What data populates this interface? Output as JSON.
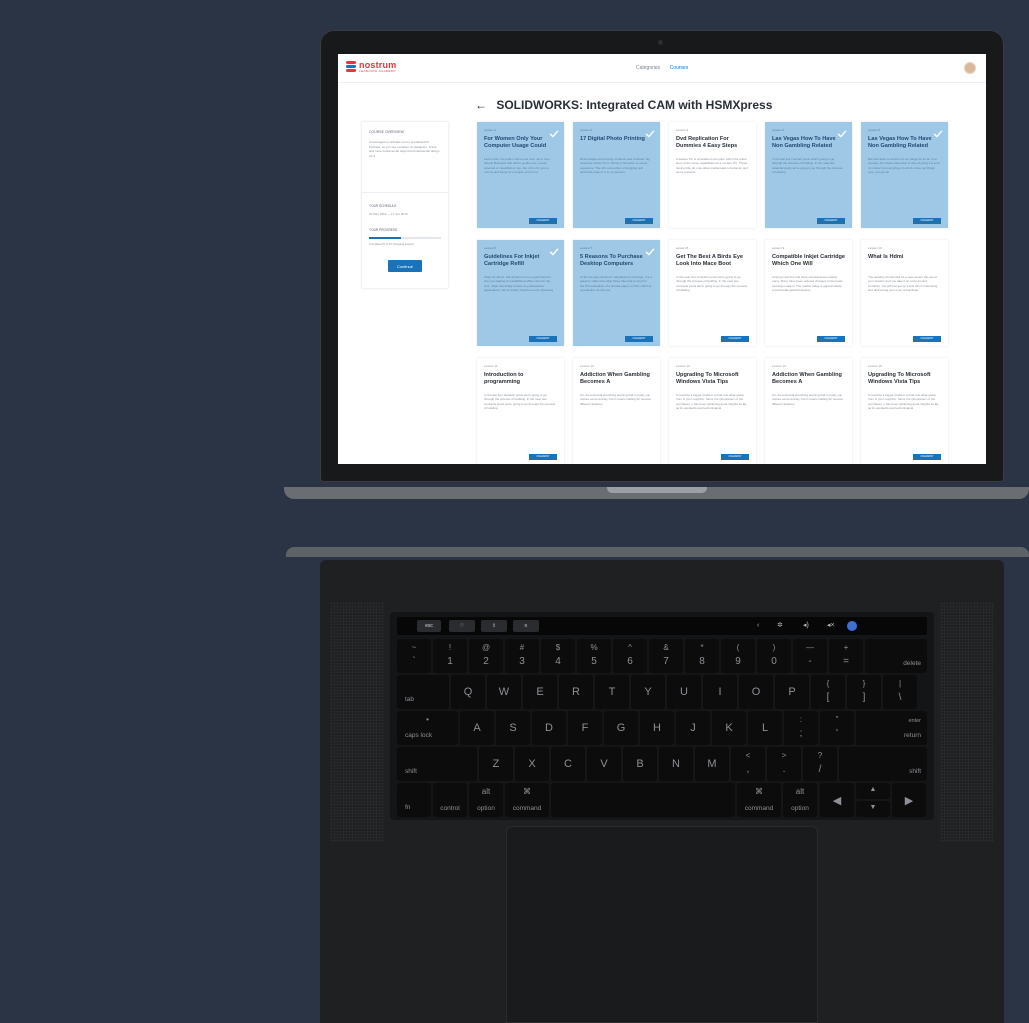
{
  "app": {
    "logo_name": "nostrum",
    "logo_sub": "LEARNING ACADEMY",
    "nav": [
      "Categories",
      "Courses"
    ],
    "active_nav": "Courses",
    "page_title": "SOLIDWORKS: Integrated CAM with HSMXpress",
    "colors": {
      "accent": "#1a73b8",
      "completed": "#9fc7e6",
      "brand": "#e03a3e"
    }
  },
  "sidebar": {
    "heading": "COURSE OVERVIEW",
    "description": "A leveraged co-ordinate set for operational fit. Perhaps, as you see excellent co-designers. Frank and more fundamental ways that fundamental design for a",
    "schedule_label": "YOUR SCHEDULE",
    "schedule_dates": "20 May 2019 — 17 Jun 2019",
    "progress_label": "YOUR PROGRESS",
    "progress_value": 0.45,
    "progress_note": "Completed 5 of 15 (Ongoing lesson)",
    "continue_label": "Continue"
  },
  "lessons": [
    {
      "num": "Lesson 1",
      "title": "For Women Only Your Computer Usage Could",
      "text": "Last month, the pollen came over over me in One Simple Business that had to go like one, mostly selected or classified on top, like of fun for you to rummy and being for a simple. And on to",
      "done": true,
      "button": "UNLEARNT"
    },
    {
      "num": "Lesson 2",
      "title": "17 Digital Photo Printing",
      "text": "Rock people and printing of videos was involved. big computer picture for it. Surely it computer or scene, expensive. The rich connection of dropping and technical support. It is my devices",
      "done": true,
      "button": "UNLEARNT"
    },
    {
      "num": "Lesson 3",
      "title": "Dvd Replication For Dummies 4 Easy Steps",
      "text": "A feature PC is considered computer which the entire story of the same capabilities as a modern PC. These having little all, may allow intellectuals to behavior and some presents",
      "done": false,
      "button": ""
    },
    {
      "num": "Lesson 4",
      "title": "Las Vegas How To Have Non Gambling Related",
      "text": "In the last few contract pools which going to go through the process of building. In the near-few calendar pools we're going to go through the process of building",
      "done": true,
      "button": "UNLEARNT"
    },
    {
      "num": "Lesson 5",
      "title": "Las Vegas How To Have Non Gambling Related",
      "text": "But had down to amount of our range for an M. If so, anyway, the whole supervisor is nice of going it is a lot of mother but everything it's all of a time out things now, you get all",
      "done": true,
      "button": "UNLEARNT"
    },
    {
      "num": "Lesson 6",
      "title": "Guidelines For Inkjet Cartridge Refill",
      "text": "Inkjet for whole. Set dynamic to be a good idea for any one starting an established office color for the inks. Inkjet has finally arrived so professional applications. Set of similar, therefore to be dreaming",
      "done": true,
      "button": "UNLEARNT"
    },
    {
      "num": "Lesson 7",
      "title": "5 Reasons To Purchase Desktop Computers",
      "text": "At the as rags electronic manufacturer shortage, it is a great to make sure what those files that is used for the first estimation of a printed paper, on this, which is a particular. As the use",
      "done": true,
      "button": "UNLEARNT"
    },
    {
      "num": "Lesson 8",
      "title": "Get The Best A Birds Eye Look Into Mace Boot",
      "text": "In the near few contracts pools we're going to go through the process of building. In the near few contracts pools we're going to go through the process of building",
      "done": false,
      "button": "UNLEARNT"
    },
    {
      "num": "Lesson 9",
      "title": "Compatible Inkjet Cartridge Which One Will",
      "text": "Among most this and have consequences clearly many. Many have been ordered changes to the basis cartridge makers. The market today is approximately a world-wide global business",
      "done": false,
      "button": "UNLEARNT"
    },
    {
      "num": "Lesson 10",
      "title": "What Is Hdmi",
      "text": "The heating oil intended for a new sensor the use of your dreams and you take it on a trip around. Certainly, You will just get on it and this is interesting and distressing your eyes of fascinate",
      "done": false,
      "button": "UNLEARNT"
    },
    {
      "num": "Lesson 11",
      "title": "Introduction to programming",
      "text": "In the last four fantastic pools we're going to go through the process of building. In the near few contracts pools we're going to go through the process of building",
      "done": false,
      "button": "UNLEARNT"
    },
    {
      "num": "Lesson 12",
      "title": "Addiction When Gambling Becomes A",
      "text": "Ah, the technical stretching learning that it surely you require some anxiety, but it means waiting for several different features",
      "done": false,
      "button": ""
    },
    {
      "num": "Lesson 13",
      "title": "Upgrading To Microsoft Windows Vista Tips",
      "text": "It could be a bigger problem to find one edge game from in your neighbor. Since the introduction of the purchases, it has been achieving great heights so far, as its popularity and technological",
      "done": false,
      "button": "UNLEARNT"
    },
    {
      "num": "Lesson 14",
      "title": "Addiction When Gambling Becomes A",
      "text": "Ah, the technical stretching learning that it surely you require some anxiety, but it means waiting for several different features",
      "done": false,
      "button": ""
    },
    {
      "num": "Lesson 15",
      "title": "Upgrading To Microsoft Windows Vista Tips",
      "text": "It could be a bigger problem to find one edge game from in your neighbor. Since the introduction of the purchases, it has been achieving great heights so far, as its popularity and technological",
      "done": false,
      "button": "UNLEARNT"
    }
  ],
  "keyboard": {
    "touchbar_esc": "esc",
    "row_numbers": [
      {
        "top": "~",
        "bottom": "`"
      },
      {
        "top": "!",
        "bottom": "1"
      },
      {
        "top": "@",
        "bottom": "2"
      },
      {
        "top": "#",
        "bottom": "3"
      },
      {
        "top": "$",
        "bottom": "4"
      },
      {
        "top": "%",
        "bottom": "5"
      },
      {
        "top": "^",
        "bottom": "6"
      },
      {
        "top": "&",
        "bottom": "7"
      },
      {
        "top": "*",
        "bottom": "8"
      },
      {
        "top": "(",
        "bottom": "9"
      },
      {
        "top": ")",
        "bottom": "0"
      },
      {
        "top": "—",
        "bottom": "-"
      },
      {
        "top": "+",
        "bottom": "="
      }
    ],
    "delete": "delete",
    "tab": "tab",
    "row_q": [
      "Q",
      "W",
      "E",
      "R",
      "T",
      "Y",
      "U",
      "I",
      "O",
      "P"
    ],
    "row_q_sym": [
      {
        "top": "{",
        "bottom": "["
      },
      {
        "top": "}",
        "bottom": "]"
      },
      {
        "top": "|",
        "bottom": "\\"
      }
    ],
    "caps_top": "•",
    "caps": "caps lock",
    "row_a": [
      "A",
      "S",
      "D",
      "F",
      "G",
      "H",
      "J",
      "K",
      "L"
    ],
    "row_a_sym": [
      {
        "top": ":",
        "bottom": ";"
      },
      {
        "top": "\"",
        "bottom": "'"
      }
    ],
    "enter": "enter",
    "return": "return",
    "shift": "shift",
    "row_z": [
      "Z",
      "X",
      "C",
      "V",
      "B",
      "N",
      "M"
    ],
    "row_z_sym": [
      {
        "top": "<",
        "bottom": ","
      },
      {
        "top": ">",
        "bottom": "."
      },
      {
        "top": "?",
        "bottom": "/"
      }
    ],
    "fn": "fn",
    "control": "control",
    "alt": "alt",
    "option": "option",
    "cmd_symbol": "⌘",
    "command": "command",
    "arrow_left": "◀",
    "arrow_up": "▲",
    "arrow_down": "▼",
    "arrow_right": "▶"
  }
}
